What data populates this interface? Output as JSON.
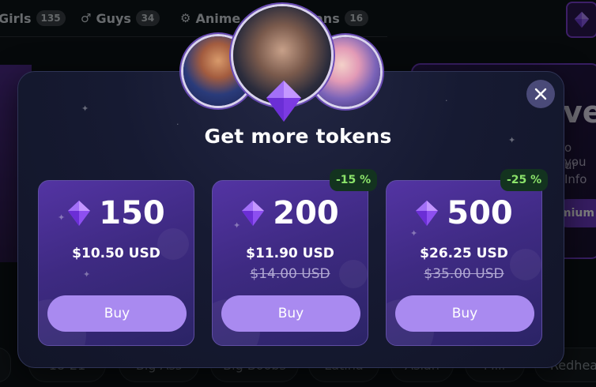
{
  "nav": {
    "items": [
      {
        "label": "Girls",
        "count": "135"
      },
      {
        "label": "Guys",
        "count": "34"
      },
      {
        "label": "Anime"
      },
      {
        "label": "ans",
        "count": "16"
      }
    ],
    "icons": {
      "guys": "male-icon",
      "anime": "gear-icon",
      "top_right": "diamond-icon"
    }
  },
  "background_banner": {
    "title": "ve",
    "line1": "o you",
    "line2": "ur Info",
    "button": "mium"
  },
  "tags": [
    "18-21",
    "Big Ass",
    "Big Boobs",
    "Latina",
    "Asian",
    "Milf",
    "Redhea"
  ],
  "modal": {
    "title": "Get more tokens",
    "close_icon": "close-icon",
    "gem_icon": "diamond-icon",
    "accent_color": "#a98af0",
    "badge_color": "#8be36a",
    "packages": [
      {
        "amount": "150",
        "price": "$10.50 USD",
        "old_price": "",
        "discount": "",
        "buy_label": "Buy"
      },
      {
        "amount": "200",
        "price": "$11.90 USD",
        "old_price": "$14.00 USD",
        "discount": "-15 %",
        "buy_label": "Buy"
      },
      {
        "amount": "500",
        "price": "$26.25 USD",
        "old_price": "$35.00 USD",
        "discount": "-25 %",
        "buy_label": "Buy"
      }
    ]
  }
}
